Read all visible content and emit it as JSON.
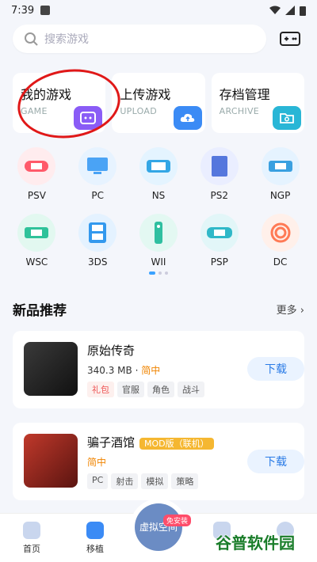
{
  "status": {
    "time": "7:39"
  },
  "search": {
    "placeholder": "搜索游戏"
  },
  "cards": [
    {
      "title": "我的游戏",
      "sub": "GAME",
      "color": "#8a5cf6"
    },
    {
      "title": "上传游戏",
      "sub": "UPLOAD",
      "color": "#3b8bf5"
    },
    {
      "title": "存档管理",
      "sub": "ARCHIVE",
      "color": "#29b6d6"
    }
  ],
  "platforms": [
    {
      "label": "PSV",
      "color": "#ff5a6a",
      "bg": "#ffecee"
    },
    {
      "label": "PC",
      "color": "#4aa3f5",
      "bg": "#e7f3ff"
    },
    {
      "label": "NS",
      "color": "#33a6e5",
      "bg": "#e4f4ff"
    },
    {
      "label": "PS2",
      "color": "#5577dd",
      "bg": "#eaeeff"
    },
    {
      "label": "NGP",
      "color": "#3aa0e0",
      "bg": "#e5f3ff"
    },
    {
      "label": "WSC",
      "color": "#2fc29a",
      "bg": "#e2f8f0"
    },
    {
      "label": "3DS",
      "color": "#3399ee",
      "bg": "#e4f2ff"
    },
    {
      "label": "WII",
      "color": "#2fbfa0",
      "bg": "#e3f8f2"
    },
    {
      "label": "PSP",
      "color": "#30b8c8",
      "bg": "#e2f6f8"
    },
    {
      "label": "DC",
      "color": "#ff7a55",
      "bg": "#fff0ea"
    }
  ],
  "section": {
    "title": "新品推荐",
    "more": "更多"
  },
  "games": [
    {
      "name": "原始传奇",
      "size": "340.3 MB",
      "status": "简中",
      "tags": [
        "礼包",
        "官服",
        "角色",
        "战斗"
      ],
      "button": "下载"
    },
    {
      "name": "骗子酒馆",
      "mod": "MOD版（联机）",
      "status": "简中",
      "tags": [
        "PC",
        "射击",
        "模拟",
        "策略"
      ],
      "button": "下载"
    }
  ],
  "nav": {
    "home": "首页",
    "port": "移植",
    "center": "虚拟空间",
    "badge": "免安装"
  },
  "watermark": "谷普软件园"
}
